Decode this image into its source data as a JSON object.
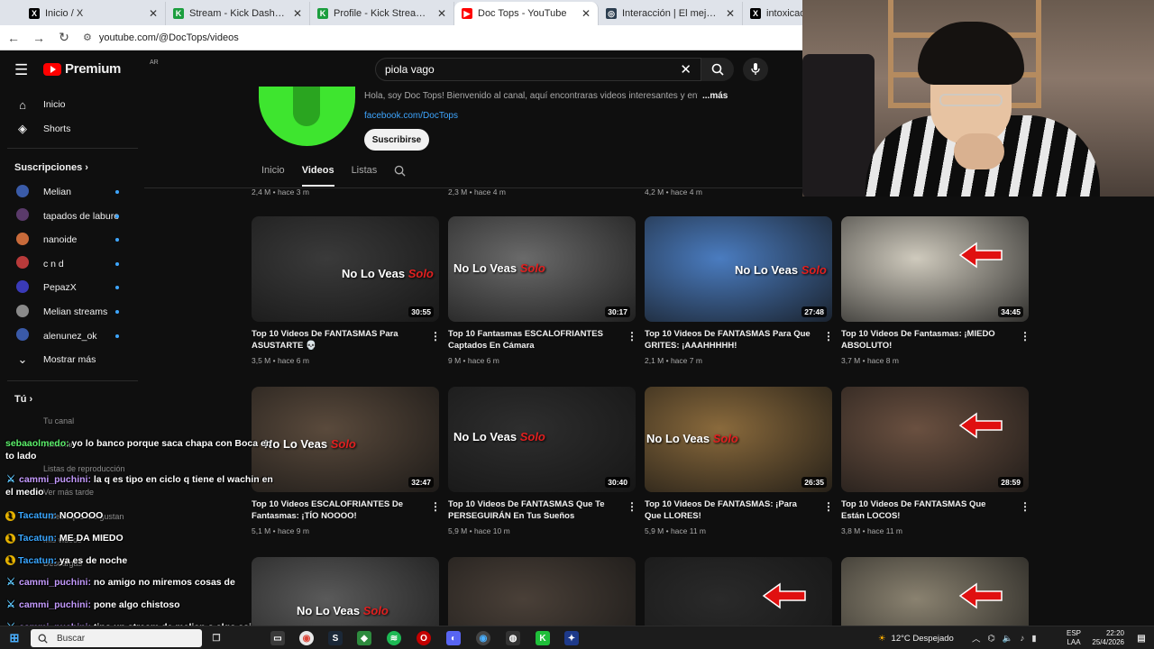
{
  "browser": {
    "tabs": [
      {
        "title": "Inicio / X",
        "fav": "X",
        "fav_color": "#000000",
        "active": false
      },
      {
        "title": "Stream - Kick Dashboard",
        "fav": "K",
        "fav_color": "#1b9e3e",
        "active": false
      },
      {
        "title": "Profile - Kick Streaming",
        "fav": "K",
        "fav_color": "#1b9e3e",
        "active": false
      },
      {
        "title": "Doc Tops - YouTube",
        "fav": "▶",
        "fav_color": "#ff0000",
        "active": true
      },
      {
        "title": "Interacción | El mejor software",
        "fav": "◎",
        "fav_color": "#2c3e50",
        "active": false
      },
      {
        "title": "intoxicado en",
        "fav": "X",
        "fav_color": "#000000",
        "active": false
      }
    ],
    "url": "youtube.com/@DocTops/videos"
  },
  "youtube": {
    "logo_text": "Premium",
    "country": "AR",
    "search_value": "piola vago",
    "sidebar": {
      "top": [
        {
          "label": "Inicio",
          "icon": "home-icon"
        },
        {
          "label": "Shorts",
          "icon": "shorts-icon"
        }
      ],
      "subs_header": "Suscripciones",
      "subs": [
        {
          "label": "Melian",
          "color": "#3a5ba8"
        },
        {
          "label": "tapados de laburo",
          "color": "#5a3a6a"
        },
        {
          "label": "nanoide",
          "color": "#c86a3a"
        },
        {
          "label": "c n d",
          "color": "#b83a3a"
        },
        {
          "label": "PepazX",
          "color": "#3a3ab8"
        },
        {
          "label": "Melian streams",
          "color": "#8a8a8a"
        },
        {
          "label": "alenunez_ok",
          "color": "#3a5aa8"
        }
      ],
      "show_more": "Mostrar más",
      "you_header": "Tú",
      "you_items": [
        "Tu canal",
        "Historial",
        "Listas de reproducción",
        "Ver más tarde",
        "Videos que me gustan",
        "Mis videos",
        "Descargas"
      ]
    },
    "channel": {
      "description": "Hola, soy Doc Tops! Bienvenido al canal, aquí encontraras videos interesantes y entretenidos",
      "more": "...más",
      "link": "facebook.com/DocTops",
      "subscribe": "Suscribirse",
      "tabs": [
        "Inicio",
        "Videos",
        "Listas"
      ],
      "active_tab": "Videos"
    },
    "prev_row_meta": [
      "2,4 M • hace 3 m",
      "2,3 M • hace 4 m",
      "4,2 M • hace 4 m"
    ],
    "videos": [
      {
        "title": "Top 10 Videos De FANTASMAS Para ASUSTARTE 💀",
        "meta": "3,5 M • hace 6 m",
        "duration": "30:55",
        "bg": "#3a3a3a",
        "overlay": true
      },
      {
        "title": "Top 10 Fantasmas ESCALOFRIANTES Captados En Cámara",
        "meta": "9 M • hace 6 m",
        "duration": "30:17",
        "bg": "#6a6a6a",
        "overlay": true
      },
      {
        "title": "Top 10 Videos De FANTASMAS Para Que GRITES: ¡AAAHHHHH!",
        "meta": "2,1 M • hace 7 m",
        "duration": "27:48",
        "bg": "#4a7cc0",
        "overlay": true
      },
      {
        "title": "Top 10 Videos De Fantasmas: ¡MIEDO ABSOLUTO!",
        "meta": "3,7 M • hace 8 m",
        "duration": "34:45",
        "bg": "#cfcabd",
        "overlay": false
      },
      {
        "title": "Top 10 Videos ESCALOFRIANTES De Fantasmas: ¡TÍO NOOOO!",
        "meta": "5,1 M • hace 9 m",
        "duration": "32:47",
        "bg": "#5a4a3c",
        "overlay": true
      },
      {
        "title": "Top 10 Videos De FANTASMAS Que Te PERSEGUIRÁN En Tus Sueños",
        "meta": "5,9 M • hace 10 m",
        "duration": "30:40",
        "bg": "#2e2e2e",
        "overlay": true
      },
      {
        "title": "Top 10 Videos De FANTASMAS: ¡Para Que LLORES!",
        "meta": "5,9 M • hace 11 m",
        "duration": "26:35",
        "bg": "#8a6a3c",
        "overlay": true
      },
      {
        "title": "Top 10 Videos De FANTASMAS Que Están LOCOS!",
        "meta": "3,8 M • hace 11 m",
        "duration": "28:59",
        "bg": "#6a5040",
        "overlay": false
      },
      {
        "title": "",
        "meta": "",
        "duration": "",
        "bg": "#5a5a5a",
        "overlay": true
      },
      {
        "title": "",
        "meta": "",
        "duration": "",
        "bg": "#4a4038",
        "overlay": false
      },
      {
        "title": "",
        "meta": "",
        "duration": "",
        "bg": "#2a2a2a",
        "overlay": false
      },
      {
        "title": "",
        "meta": "",
        "duration": "",
        "bg": "#8a8270",
        "overlay": false
      }
    ],
    "overlay_text": "No Lo Veas",
    "overlay_solo": "Solo"
  },
  "chat": [
    {
      "user": "sebaaolmedo:",
      "text": " yo lo banco porque saca chapa con Boca en",
      "cont": "to lado",
      "color": "u-green",
      "badge": ""
    },
    {
      "user": "cammi_puchini:",
      "text": " la q es tipo en ciclo q tiene el wachin en",
      "cont": "el medio",
      "color": "u-purple",
      "badge": "sword"
    },
    {
      "user": "Tacatun:",
      "text": " NOOOOO",
      "cont": "",
      "color": "u-blue",
      "badge": "gold"
    },
    {
      "user": "Tacatun:",
      "text": " ME DA MIEDO",
      "cont": "",
      "color": "u-blue",
      "badge": "gold"
    },
    {
      "user": "Tacatun:",
      "text": " ya es de noche",
      "cont": "",
      "color": "u-blue",
      "badge": "gold"
    },
    {
      "user": "cammi_puchini:",
      "text": " no amigo no miremos cosas de",
      "cont": "",
      "color": "u-purple",
      "badge": "sword"
    },
    {
      "user": "cammi_puchini:",
      "text": " pone algo chistoso",
      "cont": "",
      "color": "u-purple",
      "badge": "sword"
    },
    {
      "user": "cammi_puchini:",
      "text": " tipo un stream de melian o algo asi",
      "cont": "",
      "color": "u-purple",
      "badge": "sword"
    }
  ],
  "taskbar": {
    "search_placeholder": "Buscar",
    "weather": "12°C  Despejado",
    "lang": "ESP",
    "lang2": "LAA",
    "time": "22:20",
    "date": "25/4/2026"
  }
}
